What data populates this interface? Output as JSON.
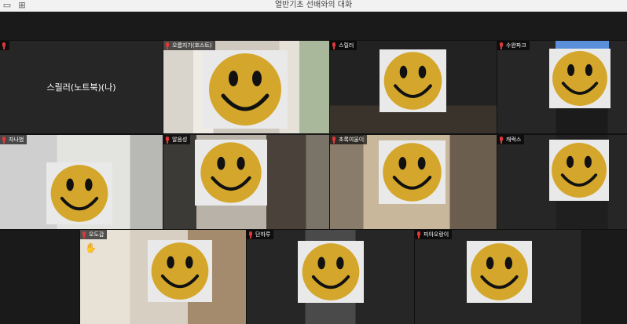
{
  "window": {
    "title": "열반기초 선배와의 대화",
    "grid_icon": "grid-view-icon"
  },
  "participants": {
    "p1": {
      "name": "스릴러(노트북)(나)"
    },
    "p2": {
      "name": "오름지기(호스트)"
    },
    "p3": {
      "name": "스릴러"
    },
    "p4": {
      "name": "수완파크"
    },
    "p5": {
      "name": "자나범"
    },
    "p6": {
      "name": "알음성"
    },
    "p7": {
      "name": "초록여울이"
    },
    "p8": {
      "name": "캐럭스"
    },
    "p9": {
      "name": "오도갑"
    },
    "p10": {
      "name": "단하루"
    },
    "p11": {
      "name": "피아오랑이"
    }
  },
  "icons": {
    "muted": "mic-muted-icon",
    "face": "smiley-face-icon",
    "raise_hand": "raised-hand-icon"
  },
  "colors": {
    "active_speaker": "#5fbf3f",
    "muted_mic": "#e0373b",
    "smiley_fill": "#d4a72c"
  }
}
